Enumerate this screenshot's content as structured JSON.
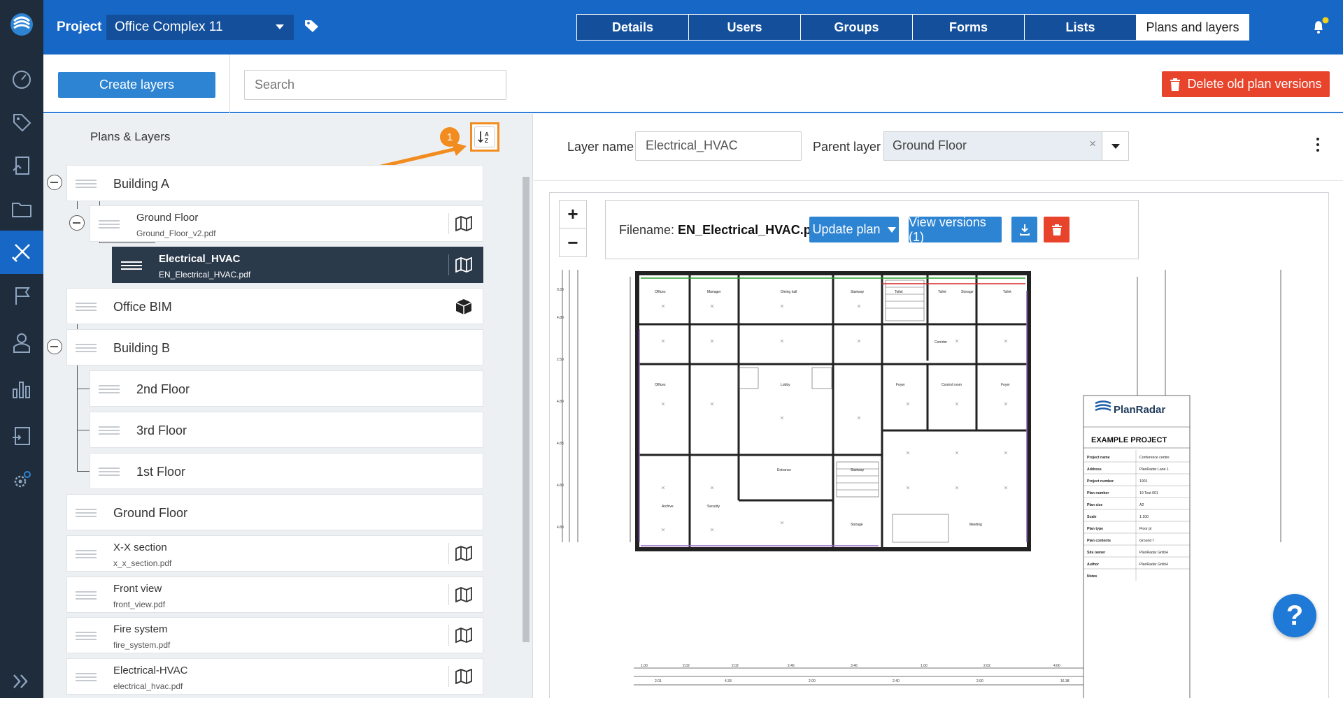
{
  "topbar": {
    "project_label": "Project",
    "project_value": "Office Complex 11",
    "tabs": [
      "Details",
      "Users",
      "Groups",
      "Forms",
      "Lists",
      "Plans and layers"
    ],
    "active_tab": "Plans and layers"
  },
  "toolbar": {
    "create_label": "Create layers",
    "search_placeholder": "Search",
    "delete_label": "Delete old plan versions"
  },
  "left_panel": {
    "title": "Plans & Layers",
    "callout_number": "1",
    "tree": [
      {
        "name": "Building A"
      },
      {
        "name": "Ground Floor",
        "file": "Ground_Floor_v2.pdf"
      },
      {
        "name": "Electrical_HVAC",
        "file": "EN_Electrical_HVAC.pdf"
      },
      {
        "name": "Office BIM"
      },
      {
        "name": "Building B"
      },
      {
        "name": "2nd Floor"
      },
      {
        "name": "3rd Floor"
      },
      {
        "name": "1st Floor"
      },
      {
        "name": "Ground Floor"
      },
      {
        "name": "X-X section",
        "file": "x_x_section.pdf"
      },
      {
        "name": "Front view",
        "file": "front_view.pdf"
      },
      {
        "name": "Fire system",
        "file": "fire_system.pdf"
      },
      {
        "name": "Electrical-HVAC",
        "file": "electrical_hvac.pdf"
      }
    ]
  },
  "right_panel": {
    "layer_name_label": "Layer name",
    "layer_name_value": "Electrical_HVAC",
    "parent_layer_label": "Parent layer",
    "parent_layer_value": "Ground Floor",
    "filename_label": "Filename:",
    "filename_value": "EN_Electrical_HVAC.pdf",
    "update_plan_label": "Update plan",
    "view_versions_label": "View versions (1)"
  },
  "drawing": {
    "brand": "PlanRadar",
    "project_heading": "EXAMPLE PROJECT",
    "title_block": [
      [
        "Project name",
        "Conference centre"
      ],
      [
        "Address",
        "PlanRadar Lane 1"
      ],
      [
        "Project number",
        "1901"
      ],
      [
        "Plan number",
        "19 Test 001"
      ],
      [
        "Plan size",
        "A2"
      ],
      [
        "Scale",
        "1:100"
      ],
      [
        "Plan type",
        "Floor pl"
      ],
      [
        "Plan contents",
        "Ground f"
      ],
      [
        "Site owner",
        "PlanRadar GmbH"
      ],
      [
        "Author",
        "PlanRadar GmbH"
      ],
      [
        "Notes",
        ""
      ]
    ],
    "rooms": [
      "Offices",
      "Manager",
      "Dining hall",
      "Stairway",
      "Toilet",
      "Toilet",
      "Storage",
      "Toilet",
      "Corridor",
      "Offices",
      "Lobby",
      "Foyer",
      "Control room",
      "Foyer",
      "Entrance",
      "Stairway",
      "Archive",
      "Security",
      "Storage",
      "Meeting"
    ]
  },
  "colors": {
    "brand_blue": "#1767c6",
    "rail": "#1f2c3c",
    "accent_orange": "#f28c1f",
    "danger": "#e8432b",
    "button_blue": "#2d84d2",
    "selected_row": "#2b3a4b"
  },
  "help_label": "?"
}
